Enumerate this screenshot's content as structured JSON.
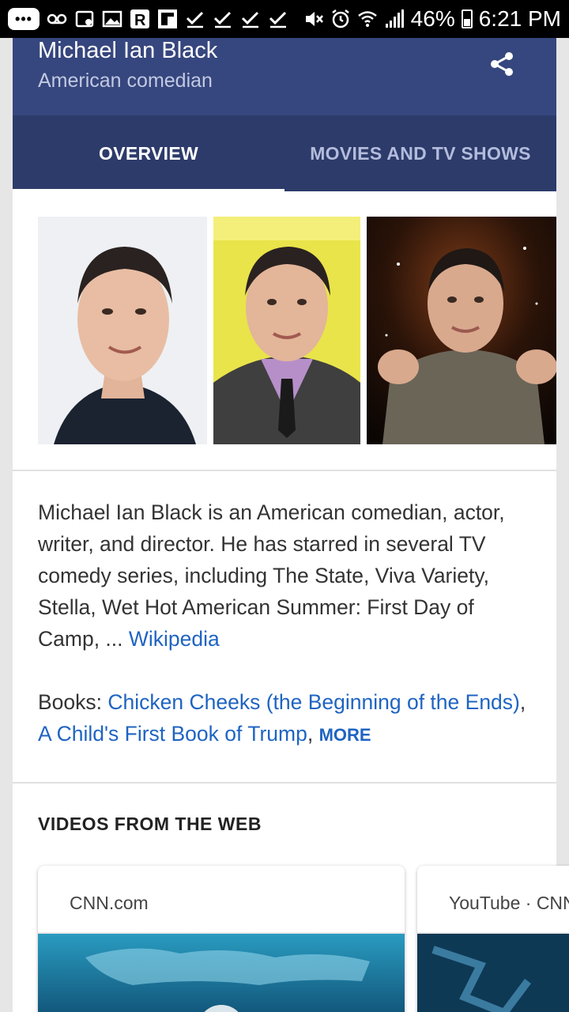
{
  "status_bar": {
    "battery_percent": "46%",
    "time": "6:21 PM",
    "chat_dots": "•••",
    "icons": [
      "chat-icon",
      "voicemail-icon",
      "cast-icon",
      "gallery-icon",
      "r-app-icon",
      "flipboard-icon",
      "check-icon",
      "check-icon",
      "check-icon",
      "check-icon",
      "mute-icon",
      "alarm-icon",
      "wifi-icon",
      "signal-icon",
      "battery-icon"
    ]
  },
  "header": {
    "title": "Michael Ian Black",
    "subtitle": "American comedian",
    "share_icon": "share-icon"
  },
  "tabs": [
    {
      "label": "OVERVIEW",
      "active": true
    },
    {
      "label": "MOVIES AND TV SHOWS",
      "active": false
    }
  ],
  "description": {
    "text": "Michael Ian Black is an American comedian, actor, writer, and director. He has starred in several TV comedy series, including The State, Viva Variety, Stella, Wet Hot American Summer: First Day of Camp, ...",
    "source_link": "Wikipedia"
  },
  "books": {
    "label": "Books: ",
    "items": [
      "Chicken Cheeks (the Beginning of the Ends)",
      "A Child's First Book of Trump"
    ],
    "separator": ", ",
    "trailing": ", ",
    "more_label": "MORE"
  },
  "videos": {
    "heading": "VIDEOS FROM THE WEB",
    "cards": [
      {
        "source": "CNN.com"
      },
      {
        "source": "YouTube · CNN"
      }
    ]
  },
  "colors": {
    "header_bg": "#36467e",
    "tabs_bg": "#2d3b6b",
    "link": "#1f64c2"
  }
}
